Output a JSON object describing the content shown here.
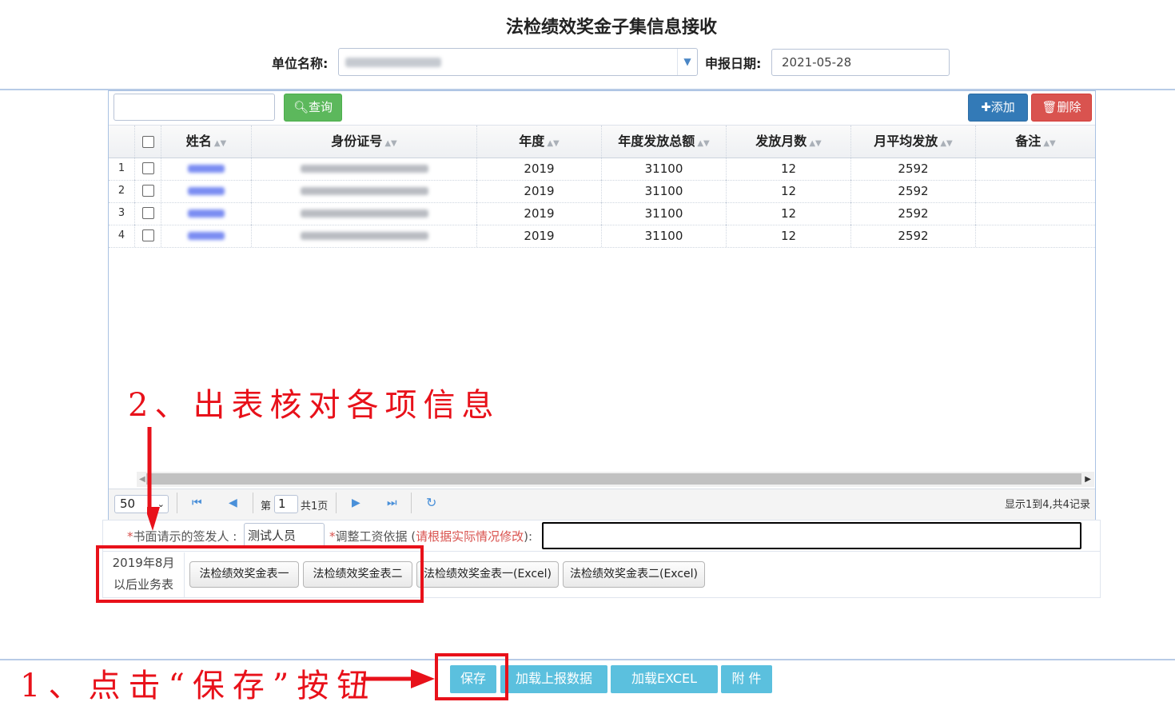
{
  "title": "法检绩效奖金子集信息接收",
  "header": {
    "unit_label": "单位名称:",
    "report_date_label": "申报日期:",
    "report_date": "2021-05-28"
  },
  "toolbar": {
    "query_label": "查询",
    "add_label": "添加",
    "delete_label": "删除"
  },
  "table": {
    "columns": [
      "姓名",
      "身份证号",
      "年度",
      "年度发放总额",
      "发放月数",
      "月平均发放",
      "备注"
    ],
    "rows": [
      {
        "n": "1",
        "year": "2019",
        "total": "31100",
        "months": "12",
        "avg": "2592"
      },
      {
        "n": "2",
        "year": "2019",
        "total": "31100",
        "months": "12",
        "avg": "2592"
      },
      {
        "n": "3",
        "year": "2019",
        "total": "31100",
        "months": "12",
        "avg": "2592"
      },
      {
        "n": "4",
        "year": "2019",
        "total": "31100",
        "months": "12",
        "avg": "2592"
      }
    ]
  },
  "pager": {
    "page_size": "50",
    "page_prefix": "第",
    "page_value": "1",
    "page_total": "共1页",
    "summary": "显示1到4,共4记录"
  },
  "form": {
    "signer_label": "书面请示的签发人 :",
    "signer_value": "测试人员",
    "basis_label": "调整工资依据 (",
    "basis_hint": "请根据实际情况修改",
    "basis_suffix": "):"
  },
  "reports": {
    "caption_line1": "2019年8月",
    "caption_line2": "以后业务表",
    "buttons": [
      "法检绩效奖金表一",
      "法检绩效奖金表二",
      "法检绩效奖金表一(Excel)",
      "法检绩效奖金表二(Excel)"
    ]
  },
  "annotations": {
    "step2": "2、出表核对各项信息",
    "step1": "1、点击“保存”按钮"
  },
  "actions": {
    "save": "保存",
    "load_report": "加载上报数据",
    "load_excel": "加载EXCEL",
    "attachment": "附 件"
  },
  "colors": {
    "annotation_red": "#e8111a",
    "light_blue_button": "#5bc0de",
    "query_green": "#5cb85c",
    "add_blue": "#337ab7",
    "delete_red": "#d9534f"
  }
}
